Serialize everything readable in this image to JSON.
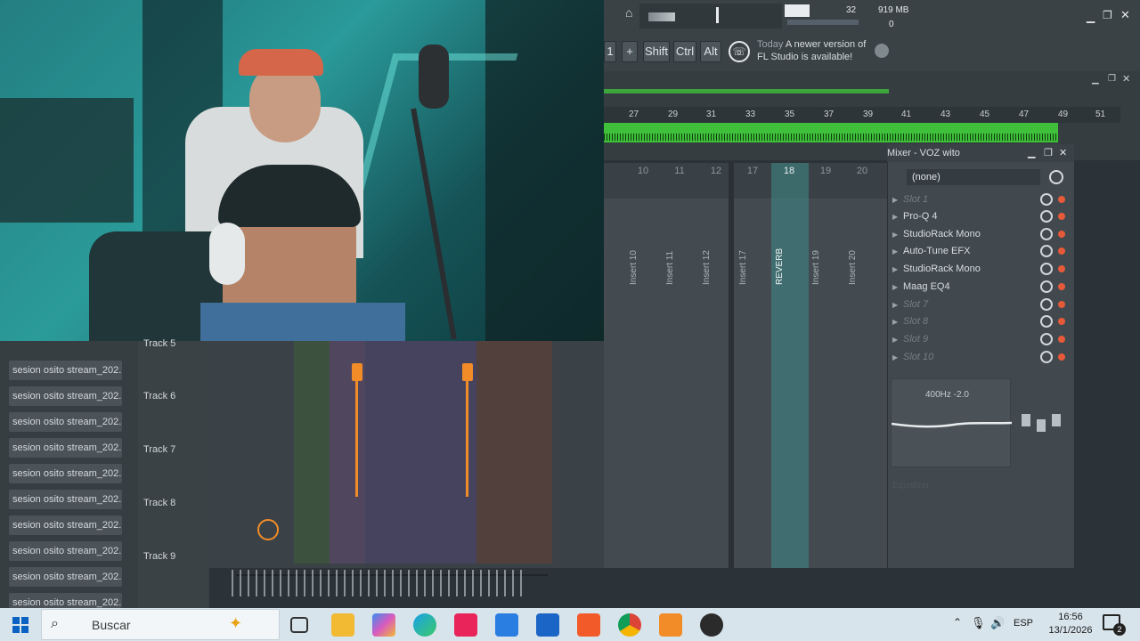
{
  "toolbar": {
    "cpu_value": "32",
    "memory_value": "919 MB",
    "polyphony_value": "0",
    "pattern_value": "1",
    "add_label": "+",
    "shift_label": "Shift",
    "ctrl_label": "Ctrl",
    "alt_label": "Alt",
    "hint_day": "Today",
    "hint_line1": "A newer version of",
    "hint_line2": "FL Studio is available!"
  },
  "ruler": {
    "bars": [
      "27",
      "29",
      "31",
      "33",
      "35",
      "37",
      "39",
      "41",
      "43",
      "45",
      "47",
      "49",
      "51"
    ]
  },
  "mixer": {
    "title": "Mixer - VOZ wito",
    "preset": "(none)",
    "insert_numbers": [
      "10",
      "11",
      "12",
      "17",
      "18",
      "19",
      "20"
    ],
    "insert_labels": [
      "Insert 10",
      "Insert 11",
      "Insert 12",
      "Insert 17",
      "REVERB",
      "Insert 19",
      "Insert 20"
    ],
    "slots": [
      {
        "label": "Slot 1",
        "empty": true
      },
      {
        "label": "Pro-Q 4",
        "empty": false
      },
      {
        "label": "StudioRack Mono",
        "empty": false
      },
      {
        "label": "Auto-Tune EFX",
        "empty": false
      },
      {
        "label": "StudioRack Mono",
        "empty": false
      },
      {
        "label": "Maag EQ4",
        "empty": false
      },
      {
        "label": "Slot 7",
        "empty": true
      },
      {
        "label": "Slot 8",
        "empty": true
      },
      {
        "label": "Slot 9",
        "empty": true
      },
      {
        "label": "Slot 10",
        "empty": true
      }
    ],
    "eq_readout": "400Hz -2.0",
    "eq_footer": "Equalizer"
  },
  "channel_list": {
    "items": [
      "sesion osito stream_202...",
      "sesion osito stream_202...",
      "sesion osito stream_202...",
      "sesion osito stream_202...",
      "sesion osito stream_202...",
      "sesion osito stream_202...",
      "sesion osito stream_202...",
      "sesion osito stream_202...",
      "sesion osito stream_202...",
      "sesion osito stream_202..."
    ]
  },
  "tracks": {
    "labels": [
      "Track 5",
      "Track 6",
      "Track 7",
      "Track 8",
      "Track 9"
    ]
  },
  "taskbar": {
    "search_placeholder": "Buscar",
    "language": "ESP",
    "time": "16:56",
    "date": "13/1/2026",
    "notification_count": "2"
  },
  "colors": {
    "accent_orange": "#f28c28",
    "clip_green": "#3fbf3a",
    "selected_strip": "#3e8a88"
  }
}
